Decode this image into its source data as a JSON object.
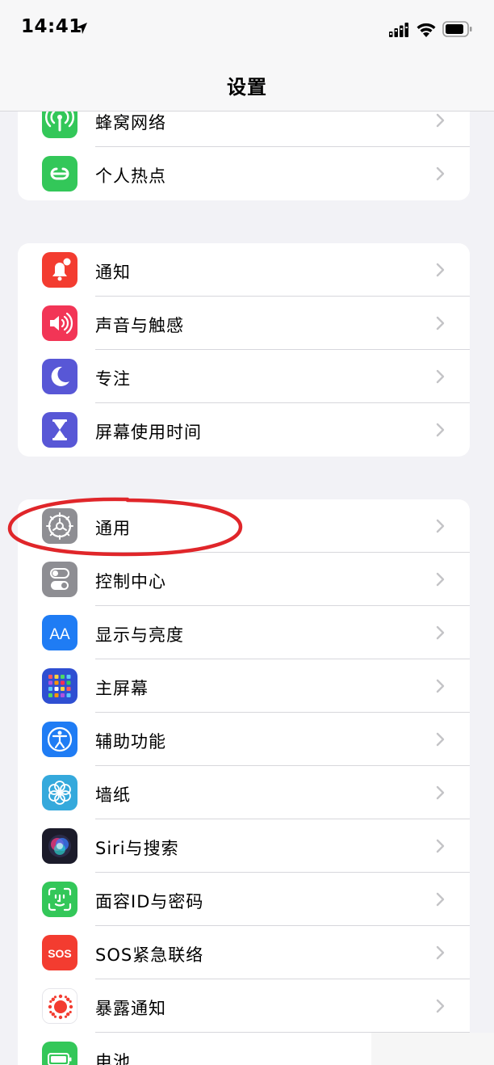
{
  "status": {
    "time": "14:41"
  },
  "nav": {
    "title": "设置"
  },
  "groups": [
    {
      "items": [
        {
          "label": "蜂窝网络",
          "icon": "cellular-icon",
          "color": "#33c759"
        },
        {
          "label": "个人热点",
          "icon": "hotspot-icon",
          "color": "#33c759"
        }
      ]
    },
    {
      "items": [
        {
          "label": "通知",
          "icon": "bell-icon",
          "color": "#f33c30"
        },
        {
          "label": "声音与触感",
          "icon": "speaker-icon",
          "color": "#f23556"
        },
        {
          "label": "专注",
          "icon": "moon-icon",
          "color": "#5857d6"
        },
        {
          "label": "屏幕使用时间",
          "icon": "hourglass-icon",
          "color": "#5857d6"
        }
      ]
    },
    {
      "items": [
        {
          "label": "通用",
          "icon": "gear-icon",
          "color": "#8e8e93"
        },
        {
          "label": "控制中心",
          "icon": "toggles-icon",
          "color": "#8e8e93"
        },
        {
          "label": "显示与亮度",
          "icon": "text-size-icon",
          "color": "#1f7cf4"
        },
        {
          "label": "主屏幕",
          "icon": "home-grid-icon",
          "color": "#2f4fd2"
        },
        {
          "label": "辅助功能",
          "icon": "accessibility-icon",
          "color": "#1f7cf4"
        },
        {
          "label": "墙纸",
          "icon": "flower-icon",
          "color": "#35a9dc"
        },
        {
          "label": "Siri与搜索",
          "icon": "siri-icon",
          "color": "#1b1b2a"
        },
        {
          "label": "面容ID与密码",
          "icon": "face-id-icon",
          "color": "#33c759"
        },
        {
          "label": "SOS紧急联络",
          "icon": "sos-icon",
          "color": "#f33c30"
        },
        {
          "label": "暴露通知",
          "icon": "exposure-icon",
          "color": "#ffffff"
        },
        {
          "label": "电池",
          "icon": "battery-app-icon",
          "color": "#33c759"
        }
      ]
    }
  ],
  "sos_icon_text": "SOS",
  "aa_icon_text": "AA",
  "highlight": {
    "target": "通用",
    "color": "#e0262a"
  }
}
